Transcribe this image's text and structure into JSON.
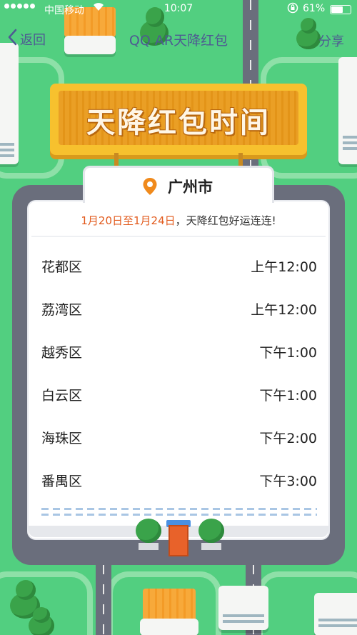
{
  "status_bar": {
    "carrier": "中国移动",
    "time": "10:07",
    "battery": "61%"
  },
  "nav": {
    "back_label": "返回",
    "title": "QQ AR天降红包",
    "share_label": "分享"
  },
  "sign": {
    "title": "天降红包时间"
  },
  "card": {
    "city": "广州市",
    "notice_date": "1月20日至1月24日",
    "notice_text": "，天降红包好运连连!",
    "rows": [
      {
        "district": "花都区",
        "time": "上午12:00"
      },
      {
        "district": "荔湾区",
        "time": "上午12:00"
      },
      {
        "district": "越秀区",
        "time": "下午1:00"
      },
      {
        "district": "白云区",
        "time": "下午1:00"
      },
      {
        "district": "海珠区",
        "time": "下午2:00"
      },
      {
        "district": "番禺区",
        "time": "下午3:00"
      }
    ]
  },
  "colors": {
    "background_green": "#52cf80",
    "road_gray": "#6a6e7c",
    "sign_yellow": "#f7c12e",
    "date_orange": "#e25a1c",
    "nav_text": "#4e5a92"
  },
  "icons": {
    "back": "chevron-left-icon",
    "location": "location-pin-icon",
    "wifi": "wifi-icon",
    "lock": "rotation-lock-icon"
  }
}
